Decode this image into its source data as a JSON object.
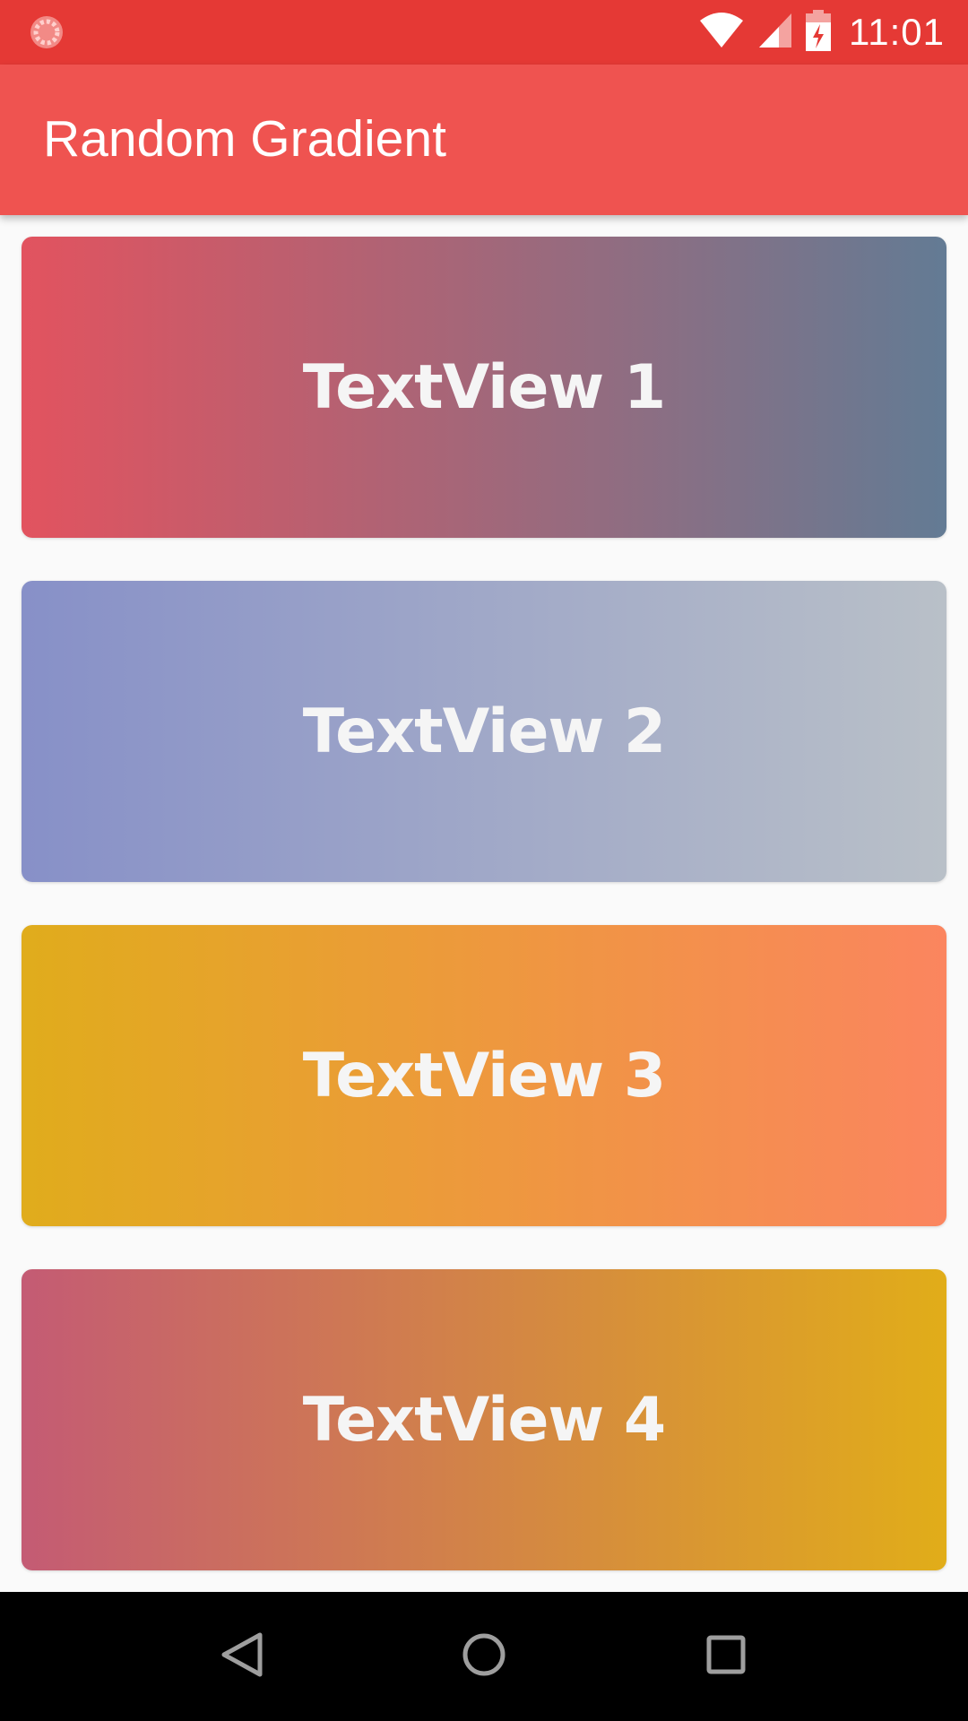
{
  "status_bar": {
    "time": "11:01",
    "icons": [
      "app-notification-icon",
      "wifi-icon",
      "cell-signal-icon",
      "battery-charging-icon"
    ],
    "background_color": "#e53935"
  },
  "app_bar": {
    "title": "Random Gradient",
    "background_color": "#ef5350"
  },
  "cards": [
    {
      "label": "TextView 1",
      "gradient": [
        "#e2535f",
        "#637b94"
      ]
    },
    {
      "label": "TextView 2",
      "gradient": [
        "#8790c8",
        "#b9c0c8"
      ]
    },
    {
      "label": "TextView 3",
      "gradient": [
        "#e0ac1c",
        "#fb855f"
      ]
    },
    {
      "label": "TextView 4",
      "gradient": [
        "#c45b74",
        "#e1ad19"
      ]
    }
  ],
  "nav_bar": {
    "buttons": [
      "back-icon",
      "home-icon",
      "recents-icon"
    ]
  }
}
